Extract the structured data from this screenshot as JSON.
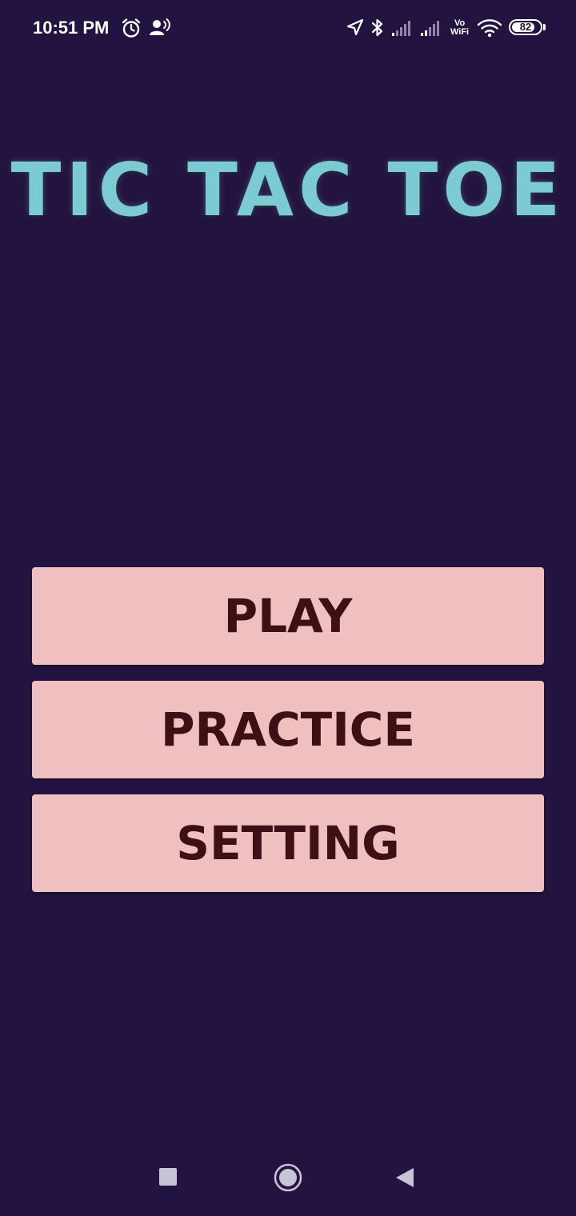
{
  "status_bar": {
    "time": "10:51 PM",
    "icons": [
      "alarm-icon",
      "hotspot-user-icon",
      "location-arrow-icon",
      "bluetooth-icon",
      "signal-1-icon",
      "signal-2-icon",
      "vowifi-icon",
      "wifi-icon",
      "battery-icon"
    ],
    "vowifi_top": "Vo",
    "vowifi_bottom": "WiFi",
    "battery_level": "82",
    "battery_fraction": 0.82
  },
  "app": {
    "title": "TIC TAC TOE",
    "buttons": {
      "play": "PLAY",
      "practice": "PRACTICE",
      "setting": "SETTING"
    }
  },
  "nav_bar": {
    "icons": [
      "recents-square-icon",
      "home-circle-icon",
      "back-triangle-icon"
    ]
  },
  "colors": {
    "background": "#231340",
    "title": "#7ccad2",
    "button_fill": "#f0bfc0",
    "button_text": "#3d1016",
    "nav_icon": "#c7c4d6"
  }
}
